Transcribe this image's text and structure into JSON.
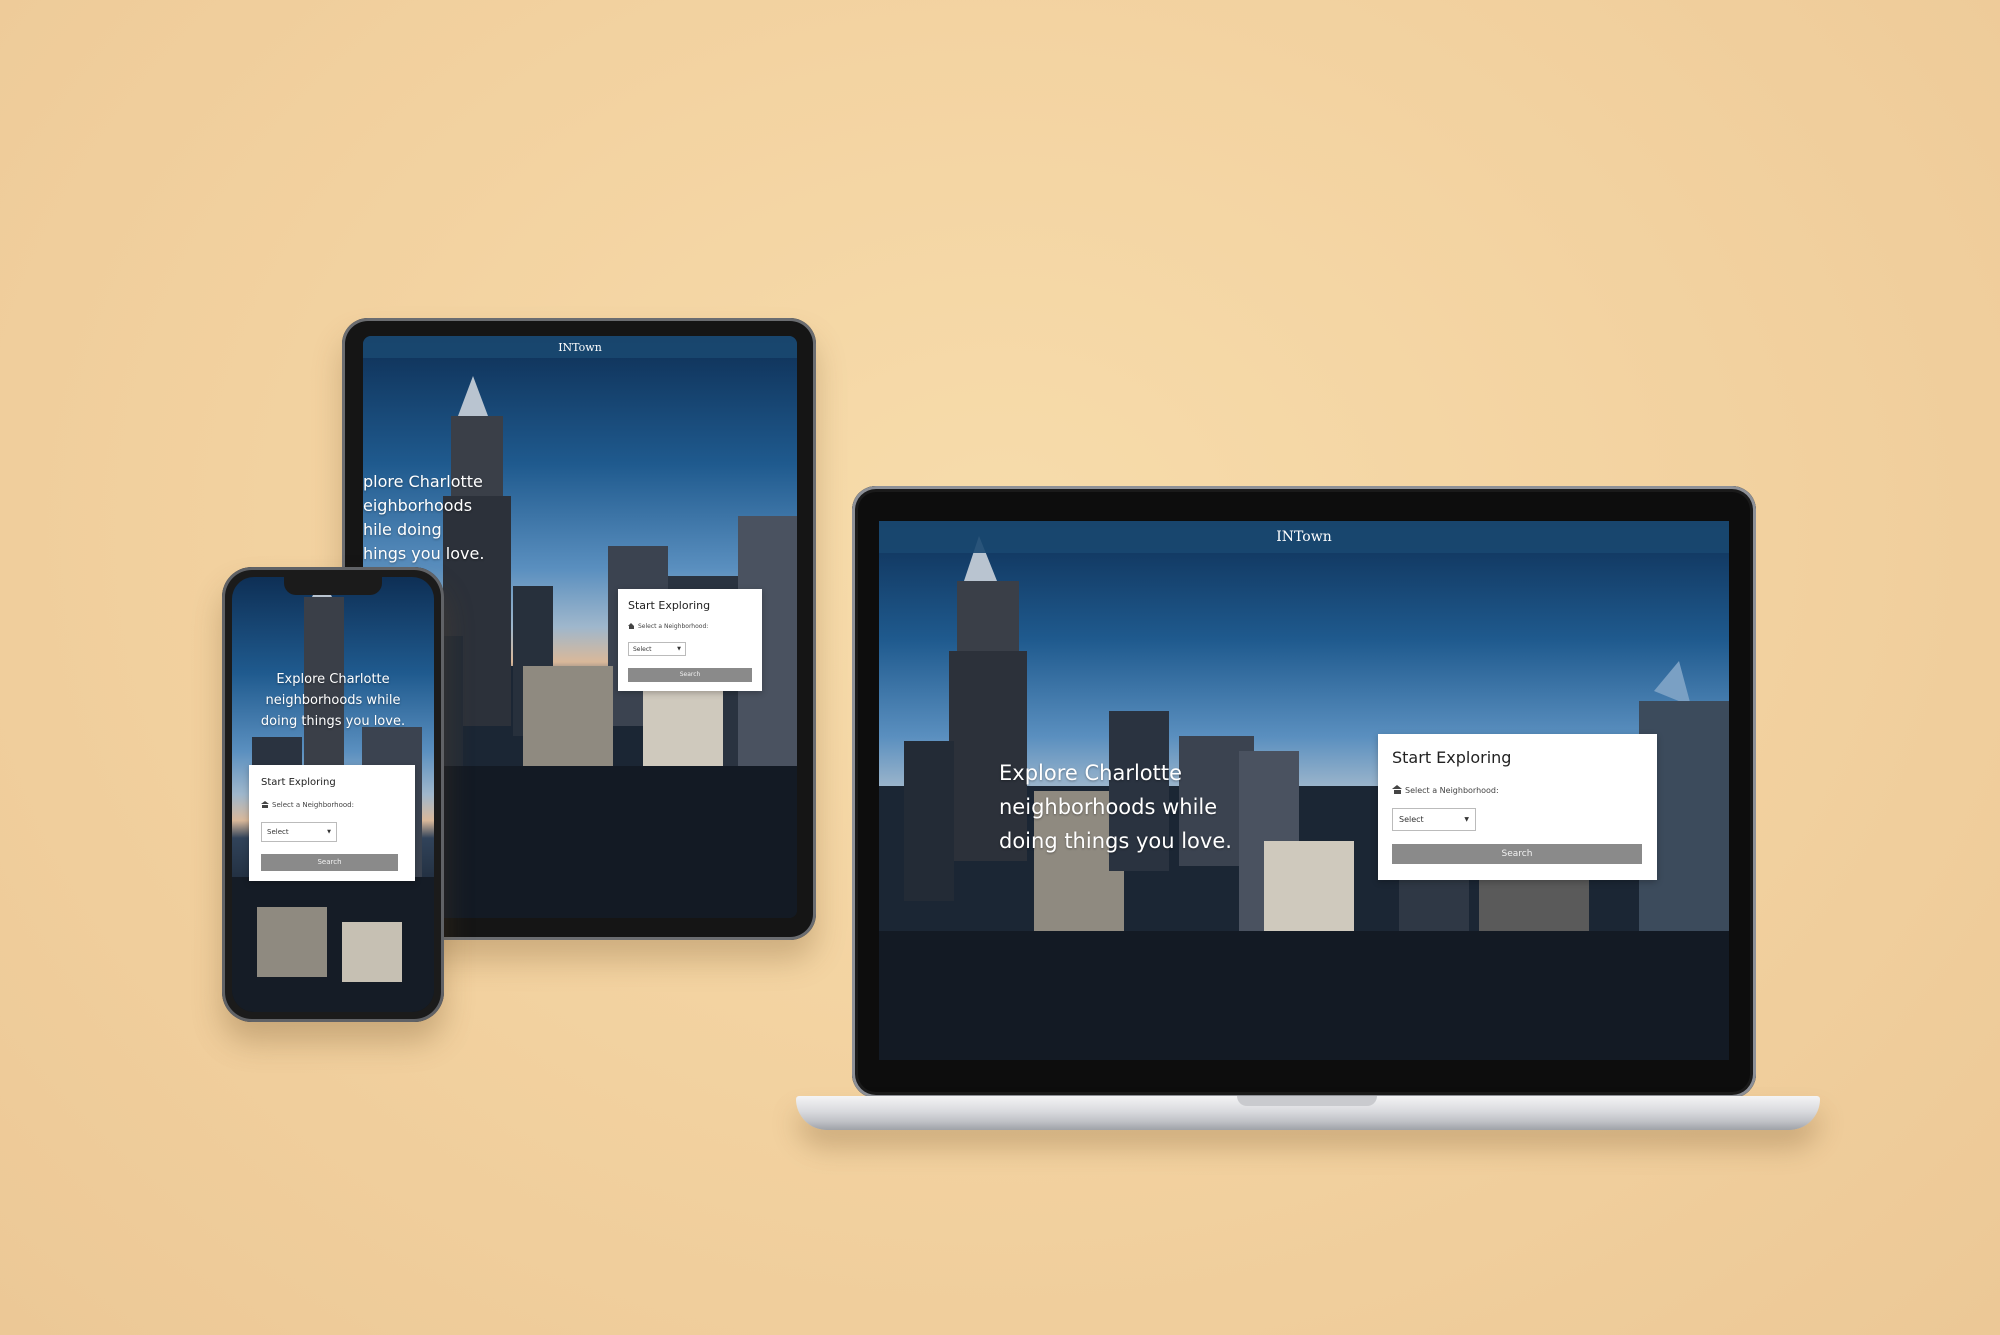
{
  "site": {
    "brand": "INTown",
    "hero_text": "Explore Charlotte neighborhoods while doing things you love.",
    "hero_lines": [
      "Explore Charlotte",
      "neighborhoods while",
      "doing things you love."
    ],
    "form": {
      "title": "Start Exploring",
      "label": "Select a Neighborhood:",
      "select_value": "Select",
      "search_label": "Search"
    }
  },
  "tablet": {
    "hero_lines": [
      "plore Charlotte",
      "eighborhoods",
      "hile doing",
      "hings you love."
    ]
  },
  "colors": {
    "background": "#f2d19f",
    "navbar": "#1a4870",
    "search_button": "#8a8a8a",
    "card": "#ffffff"
  }
}
